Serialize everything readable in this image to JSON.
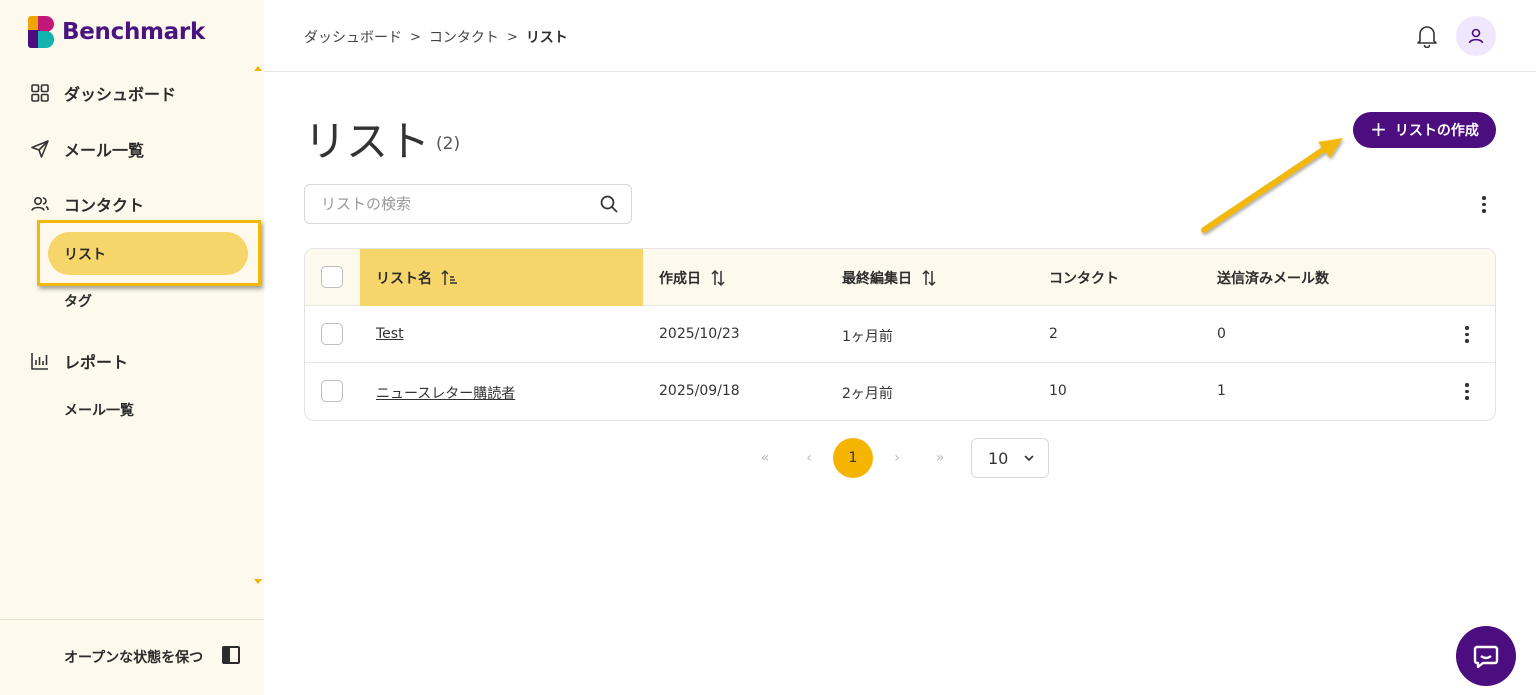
{
  "brand": {
    "name": "Benchmark"
  },
  "sidebar": {
    "items": [
      {
        "label": "ダッシュボード",
        "icon": "grid-icon"
      },
      {
        "label": "メール一覧",
        "icon": "send-icon"
      },
      {
        "label": "コンタクト",
        "icon": "users-icon"
      },
      {
        "label": "レポート",
        "icon": "bar-chart-icon"
      }
    ],
    "contact_sub": {
      "active": "リスト",
      "tags": "タグ"
    },
    "report_sub": "メール一覧",
    "keep_open": "オープンな状態を保つ"
  },
  "header": {
    "breadcrumb": [
      "ダッシュボード",
      "コンタクト",
      "リスト"
    ],
    "separator": ">"
  },
  "main": {
    "title": "リスト",
    "count": "(2)",
    "create_button": "リストの作成",
    "search_placeholder": "リストの検索"
  },
  "table": {
    "columns": [
      "リスト名",
      "作成日",
      "最終編集日",
      "コンタクト",
      "送信済みメール数"
    ],
    "rows": [
      {
        "name": "Test",
        "created": "2025/10/23",
        "edited": "1ヶ月前",
        "contacts": "2",
        "sent": "0"
      },
      {
        "name": "ニュースレター購読者",
        "created": "2025/09/18",
        "edited": "2ヶ月前",
        "contacts": "10",
        "sent": "1"
      }
    ]
  },
  "pagination": {
    "current": "1",
    "page_size": "10",
    "first": "«",
    "prev": "‹",
    "next": "›",
    "last": "»"
  },
  "colors": {
    "brand_purple": "#4c0d7f",
    "highlight_yellow": "#f6d56a",
    "accent_orange": "#f5b400",
    "sidebar_bg": "#fdf9ec"
  }
}
